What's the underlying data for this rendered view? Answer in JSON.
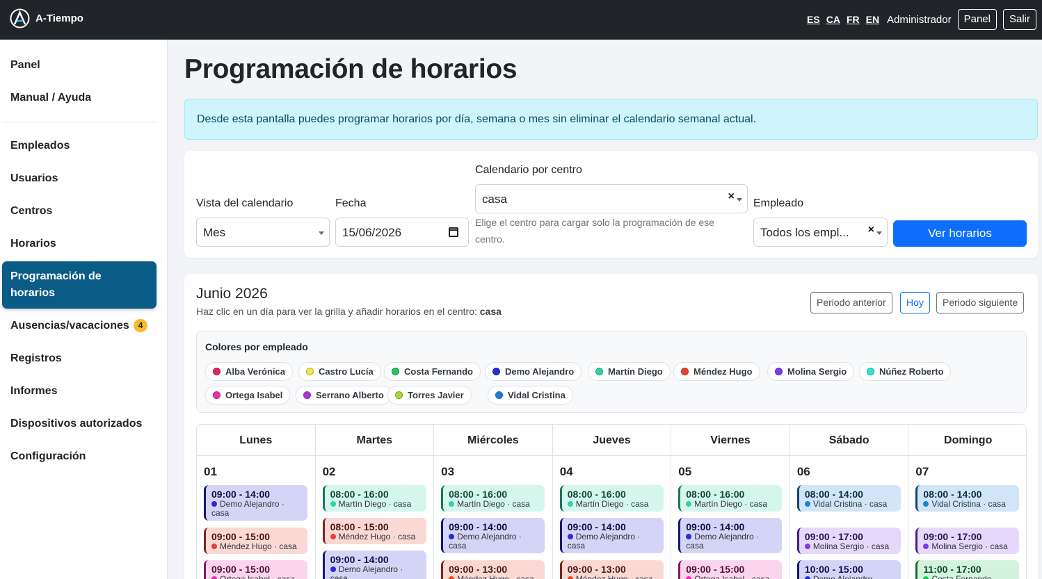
{
  "app": {
    "name": "A-Tiempo",
    "languages": [
      "ES",
      "CA",
      "FR",
      "EN"
    ],
    "user": "Administrador",
    "panel_button": "Panel",
    "logout_button": "Salir"
  },
  "sidebar": {
    "items": [
      {
        "label": "Panel"
      },
      {
        "label": "Manual / Ayuda"
      },
      {
        "label": "Empleados"
      },
      {
        "label": "Usuarios"
      },
      {
        "label": "Centros"
      },
      {
        "label": "Horarios"
      },
      {
        "label": "Programación de horarios",
        "active": true
      },
      {
        "label": "Ausencias/vacaciones",
        "badge": "4"
      },
      {
        "label": "Registros"
      },
      {
        "label": "Informes"
      },
      {
        "label": "Dispositivos autorizados"
      },
      {
        "label": "Configuración"
      }
    ]
  },
  "page": {
    "title": "Programación de horarios",
    "alert": "Desde esta pantalla puedes programar horarios por día, semana o mes sin eliminar el calendario semanal actual."
  },
  "filters": {
    "view_label": "Vista del calendario",
    "view_value": "Mes",
    "date_label": "Fecha",
    "date_value": "15/06/2026",
    "center_label": "Calendario por centro",
    "center_value": "casa",
    "center_help": "Elige el centro para cargar solo la programación de ese centro.",
    "employee_label": "Empleado",
    "employee_value": "Todos los empl...",
    "submit_label": "Ver horarios"
  },
  "calendar": {
    "month_title": "Junio 2026",
    "subtitle": "Haz clic en un día para ver la grilla y añadir horarios en el centro:",
    "center": "casa",
    "prev_label": "Periodo anterior",
    "today_label": "Hoy",
    "next_label": "Periodo siguiente",
    "legend_title": "Colores por empleado",
    "legend": [
      {
        "name": "Alba Verónica",
        "color": "#e0245e"
      },
      {
        "name": "Castro Lucía",
        "color": "#eeee44"
      },
      {
        "name": "Costa Fernando",
        "color": "#22c55e"
      },
      {
        "name": "Demo Alejandro",
        "color": "#2a2ad6"
      },
      {
        "name": "Martín Diego",
        "color": "#2dd4a2"
      },
      {
        "name": "Méndez Hugo",
        "color": "#e5432f"
      },
      {
        "name": "Molina Sergio",
        "color": "#7c3aed"
      },
      {
        "name": "Núñez Roberto",
        "color": "#2ee5d6"
      },
      {
        "name": "Ortega Isabel",
        "color": "#ec2fa6"
      },
      {
        "name": "Serrano Alberto",
        "color": "#a63ad6"
      },
      {
        "name": "Torres Javier",
        "color": "#a3d93a"
      },
      {
        "name": "Vidal Cristina",
        "color": "#1d7fd9"
      }
    ],
    "days": [
      {
        "name": "Lunes",
        "num": "01",
        "shifts": [
          {
            "time": "09:00 - 14:00",
            "who": "Demo Alejandro · casa"
          },
          {
            "time": "09:00 - 15:00",
            "who": "Méndez Hugo · casa"
          },
          {
            "time": "09:00 - 15:00",
            "who": "Ortega Isabel · casa"
          }
        ]
      },
      {
        "name": "Martes",
        "num": "02",
        "shifts": [
          {
            "time": "08:00 - 16:00",
            "who": "Martín Diego · casa"
          },
          {
            "time": "08:00 - 15:00",
            "who": "Méndez Hugo · casa"
          },
          {
            "time": "09:00 - 14:00",
            "who": "Demo Alejandro · casa"
          }
        ]
      },
      {
        "name": "Miércoles",
        "num": "03",
        "shifts": [
          {
            "time": "08:00 - 16:00",
            "who": "Martín Diego · casa"
          },
          {
            "time": "09:00 - 14:00",
            "who": "Demo Alejandro · casa"
          },
          {
            "time": "09:00 - 13:00",
            "who": "Méndez Hugo · casa"
          }
        ]
      },
      {
        "name": "Jueves",
        "num": "04",
        "shifts": [
          {
            "time": "08:00 - 16:00",
            "who": "Martín Diego · casa"
          },
          {
            "time": "09:00 - 14:00",
            "who": "Demo Alejandro · casa"
          },
          {
            "time": "09:00 - 13:00",
            "who": "Méndez Hugo · casa"
          }
        ]
      },
      {
        "name": "Viernes",
        "num": "05",
        "shifts": [
          {
            "time": "08:00 - 16:00",
            "who": "Martín Diego · casa"
          },
          {
            "time": "09:00 - 14:00",
            "who": "Demo Alejandro · casa"
          },
          {
            "time": "09:00 - 15:00",
            "who": "Ortega Isabel · casa"
          }
        ]
      },
      {
        "name": "Sábado",
        "num": "06",
        "shifts": [
          {
            "time": "08:00 - 14:00",
            "who": "Vidal Cristina · casa"
          },
          {
            "time": "09:00 - 17:00",
            "who": "Molina Sergio · casa"
          },
          {
            "time": "10:00 - 15:00",
            "who": "Demo Alejandro · casa"
          }
        ]
      },
      {
        "name": "Domingo",
        "num": "07",
        "shifts": [
          {
            "time": "08:00 - 14:00",
            "who": "Vidal Cristina · casa"
          },
          {
            "time": "09:00 - 17:00",
            "who": "Molina Sergio · casa"
          },
          {
            "time": "11:00 - 17:00",
            "who": "Costa Fernando · casa"
          }
        ]
      }
    ]
  }
}
